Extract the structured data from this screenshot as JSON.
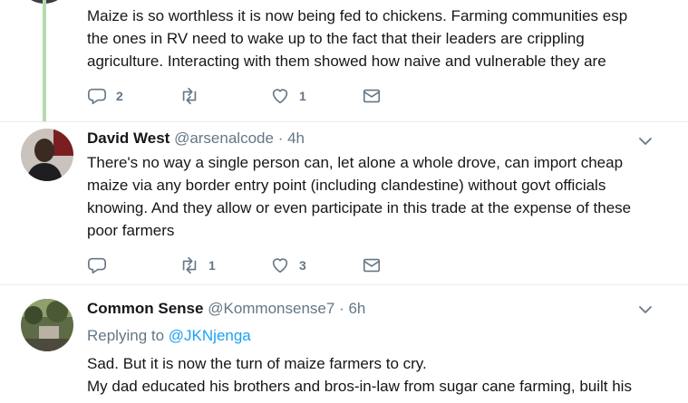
{
  "tweets": [
    {
      "body_lines": [
        "Maize is so worthless it is now being fed to chickens. Farming communities esp",
        "the ones in RV need to wake up to the fact that their leaders are crippling",
        "agriculture. Interacting with them showed how naive and vulnerable they are"
      ],
      "replies": "2",
      "retweets": "",
      "likes": "1"
    },
    {
      "name": "David West",
      "handle": "@arsenalcode",
      "separator": "·",
      "time": "4h",
      "body_lines": [
        "There's no way a single person can, let alone a whole drove, can import cheap",
        "maize via any border entry point (including clandestine) without govt officials",
        "knowing. And they allow or even participate in this trade at the expense of these",
        "poor farmers"
      ],
      "replies": "",
      "retweets": "1",
      "likes": "3"
    },
    {
      "name": "Common Sense",
      "handle": "@Kommonsense7",
      "separator": "·",
      "time": "6h",
      "replying_prefix": "Replying to",
      "replying_to": "@JKNjenga",
      "body_lines": [
        "Sad. But it is now the turn of maize farmers to cry.",
        "My dad educated his brothers and bros-in-law from sugar cane farming, built his"
      ]
    }
  ],
  "icons": {
    "reply": "reply-icon",
    "retweet": "retweet-icon",
    "like": "heart-icon",
    "dm": "envelope-icon",
    "menu": "chevron-down-icon"
  },
  "colors": {
    "text": "#14171a",
    "secondary": "#657786",
    "link": "#1da1f2",
    "thread_line": "#b8d9b0",
    "divider": "#e6ecf0"
  }
}
